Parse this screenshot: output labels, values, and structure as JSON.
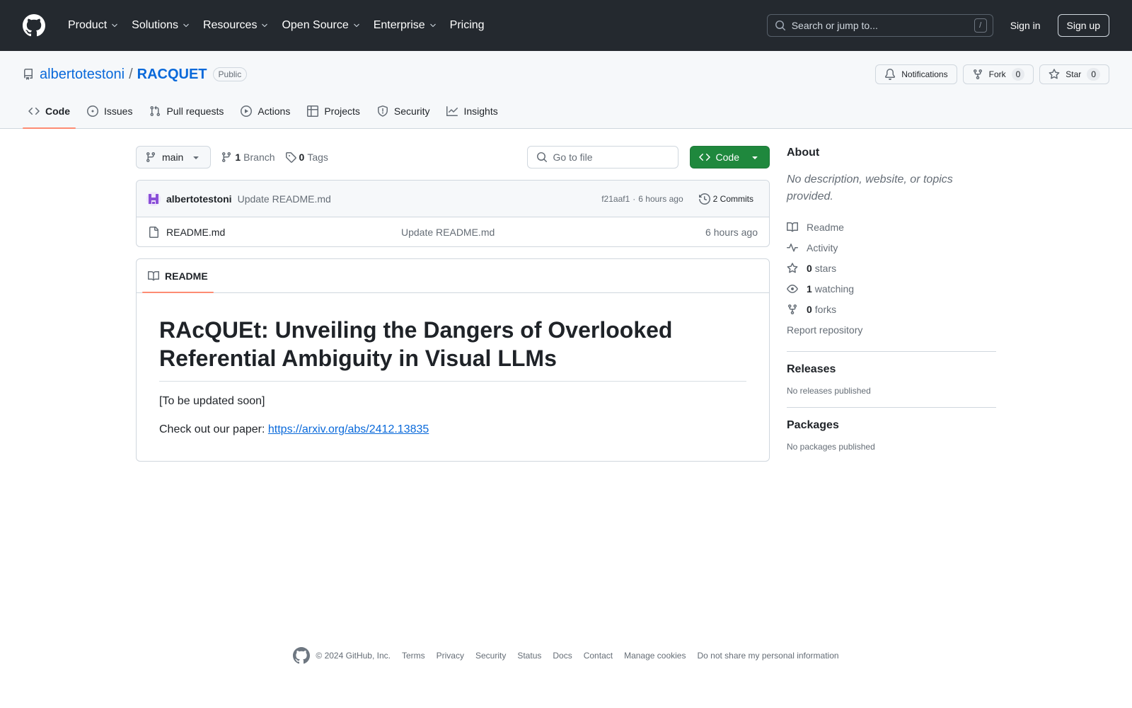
{
  "header": {
    "nav": [
      {
        "label": "Product",
        "has_menu": true
      },
      {
        "label": "Solutions",
        "has_menu": true
      },
      {
        "label": "Resources",
        "has_menu": true
      },
      {
        "label": "Open Source",
        "has_menu": true
      },
      {
        "label": "Enterprise",
        "has_menu": true
      },
      {
        "label": "Pricing",
        "has_menu": false
      }
    ],
    "search_placeholder": "Search or jump to...",
    "search_shortcut": "/",
    "sign_in": "Sign in",
    "sign_up": "Sign up"
  },
  "repo": {
    "owner": "albertotestoni",
    "separator": "/",
    "name": "RACQUET",
    "visibility": "Public",
    "actions": {
      "notifications": "Notifications",
      "fork": "Fork",
      "fork_count": "0",
      "star": "Star",
      "star_count": "0"
    },
    "tabs": [
      {
        "label": "Code",
        "icon": "code-icon",
        "active": true
      },
      {
        "label": "Issues",
        "icon": "issue-opened-icon",
        "active": false
      },
      {
        "label": "Pull requests",
        "icon": "git-pull-request-icon",
        "active": false
      },
      {
        "label": "Actions",
        "icon": "play-icon",
        "active": false
      },
      {
        "label": "Projects",
        "icon": "table-icon",
        "active": false
      },
      {
        "label": "Security",
        "icon": "shield-icon",
        "active": false
      },
      {
        "label": "Insights",
        "icon": "graph-icon",
        "active": false
      }
    ]
  },
  "filenav": {
    "branch": "main",
    "branch_count": "1",
    "branch_label": "Branch",
    "tag_count": "0",
    "tag_label": "Tags",
    "goto_placeholder": "Go to file",
    "code_button": "Code"
  },
  "latest_commit": {
    "author": "albertotestoni",
    "message": "Update README.md",
    "hash": "f21aaf1",
    "dot": "·",
    "age": "6 hours ago",
    "commits_label": "2 Commits"
  },
  "files": [
    {
      "name": "README.md",
      "message": "Update README.md",
      "age": "6 hours ago"
    }
  ],
  "readme": {
    "tab_label": "README",
    "heading": "RAcQUEt: Unveiling the Dangers of Overlooked Referential Ambiguity in Visual LLMs",
    "paragraph1": "[To be updated soon]",
    "paragraph2_prefix": "Check out our paper:",
    "paper_link": "https://arxiv.org/abs/2412.13835"
  },
  "sidebar": {
    "about_title": "About",
    "about_desc": "No description, website, or topics provided.",
    "readme": "Readme",
    "activity": "Activity",
    "stars_count": "0",
    "stars_label": "stars",
    "watching_count": "1",
    "watching_label": "watching",
    "forks_count": "0",
    "forks_label": "forks",
    "report": "Report repository",
    "releases_title": "Releases",
    "releases_note": "No releases published",
    "packages_title": "Packages",
    "packages_note": "No packages published"
  },
  "footer": {
    "copyright": "© 2024 GitHub, Inc.",
    "links": [
      "Terms",
      "Privacy",
      "Security",
      "Status",
      "Docs",
      "Contact",
      "Manage cookies",
      "Do not share my personal information"
    ]
  },
  "colors": {
    "header_bg": "#24292f",
    "link": "#0969da",
    "primary_button": "#1f883d",
    "active_tab_underline": "#fd8c73",
    "muted_text": "#656d76"
  }
}
